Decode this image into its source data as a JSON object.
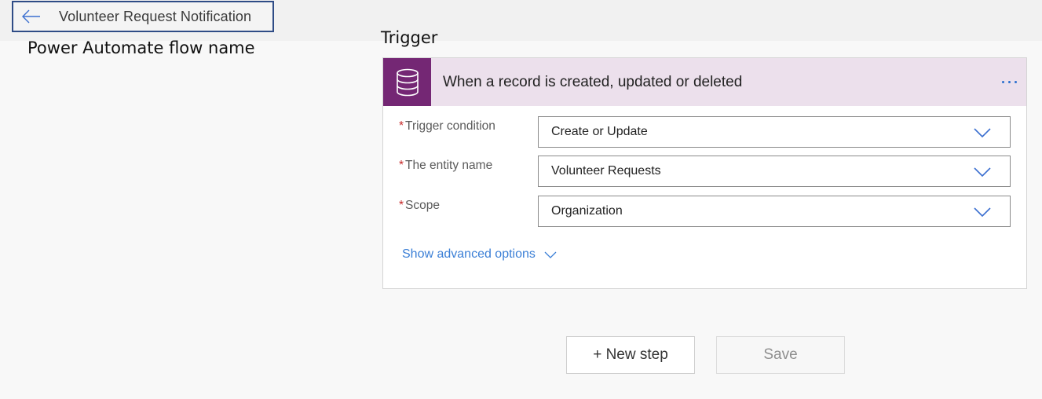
{
  "header": {
    "flow_title": "Volunteer Request Notification"
  },
  "annotations": {
    "flow_name_caption": "Power Automate flow name",
    "trigger_caption": "Trigger"
  },
  "trigger_card": {
    "title": "When a record is created, updated or deleted",
    "icon": "database-icon",
    "accent_color": "#742774",
    "header_bg": "#ece0ec",
    "fields": [
      {
        "required_mark": "*",
        "label": "Trigger condition",
        "value": "Create or Update"
      },
      {
        "required_mark": "*",
        "label": "The entity name",
        "value": "Volunteer Requests"
      },
      {
        "required_mark": "*",
        "label": "Scope",
        "value": "Organization"
      }
    ],
    "advanced_link": "Show advanced options"
  },
  "actions": {
    "new_step_label": "+ New step",
    "save_label": "Save"
  }
}
